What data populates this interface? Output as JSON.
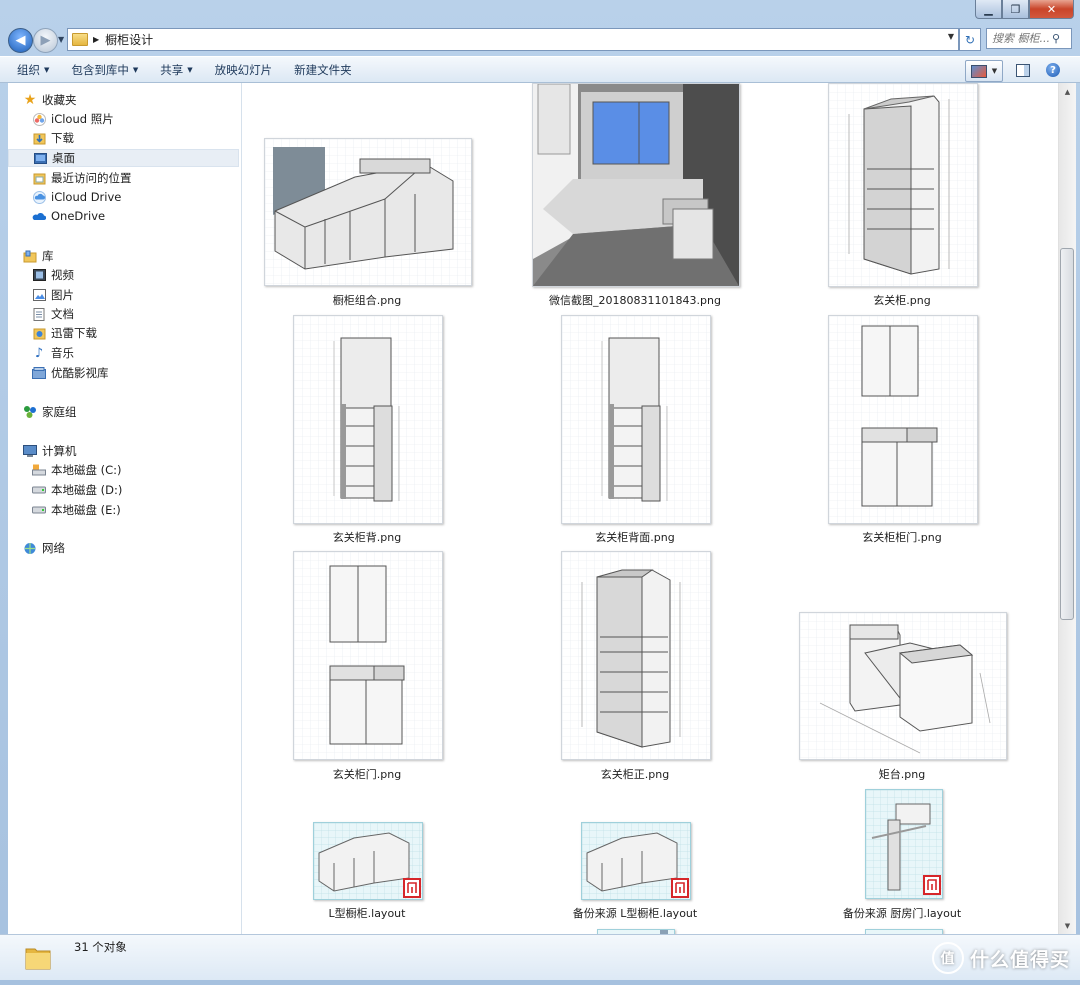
{
  "window": {
    "min_glyph": "▁",
    "max_glyph": "❐",
    "close_glyph": "✕"
  },
  "address": {
    "path": "橱柜设计",
    "search_placeholder": "搜索 橱柜..."
  },
  "toolbar": {
    "organize": "组织",
    "include_library": "包含到库中",
    "share": "共享",
    "slideshow": "放映幻灯片",
    "new_folder": "新建文件夹"
  },
  "nav": {
    "favorites": {
      "label": "收藏夹",
      "items": [
        "iCloud 照片",
        "下载",
        "桌面",
        "最近访问的位置",
        "iCloud Drive",
        "OneDrive"
      ],
      "selected": "桌面"
    },
    "libraries": {
      "label": "库",
      "items": [
        "视频",
        "图片",
        "文档",
        "迅雷下载",
        "音乐",
        "优酷影视库"
      ]
    },
    "homegroup": "家庭组",
    "computer": {
      "label": "计算机",
      "items": [
        "本地磁盘 (C:)",
        "本地磁盘 (D:)",
        "本地磁盘 (E:)"
      ]
    },
    "network": "网络"
  },
  "files": [
    {
      "name": "橱柜组合.png"
    },
    {
      "name": "微信截图_20180831101843.png"
    },
    {
      "name": "玄关柜.png"
    },
    {
      "name": "玄关柜背.png"
    },
    {
      "name": "玄关柜背面.png"
    },
    {
      "name": "玄关柜柜门.png"
    },
    {
      "name": "玄关柜门.png"
    },
    {
      "name": "玄关柜正.png"
    },
    {
      "name": "矩台.png"
    },
    {
      "name": "L型橱柜.layout"
    },
    {
      "name": "备份来源 L型橱柜.layout"
    },
    {
      "name": "备份来源 厨房门.layout"
    }
  ],
  "status": {
    "count": "31 个对象"
  },
  "watermark": {
    "glyph": "值",
    "text": "什么值得买"
  },
  "colors": {
    "accent": "#1d5fb8",
    "selection": "#e8eef5",
    "layout_badge": "#d6262a"
  }
}
